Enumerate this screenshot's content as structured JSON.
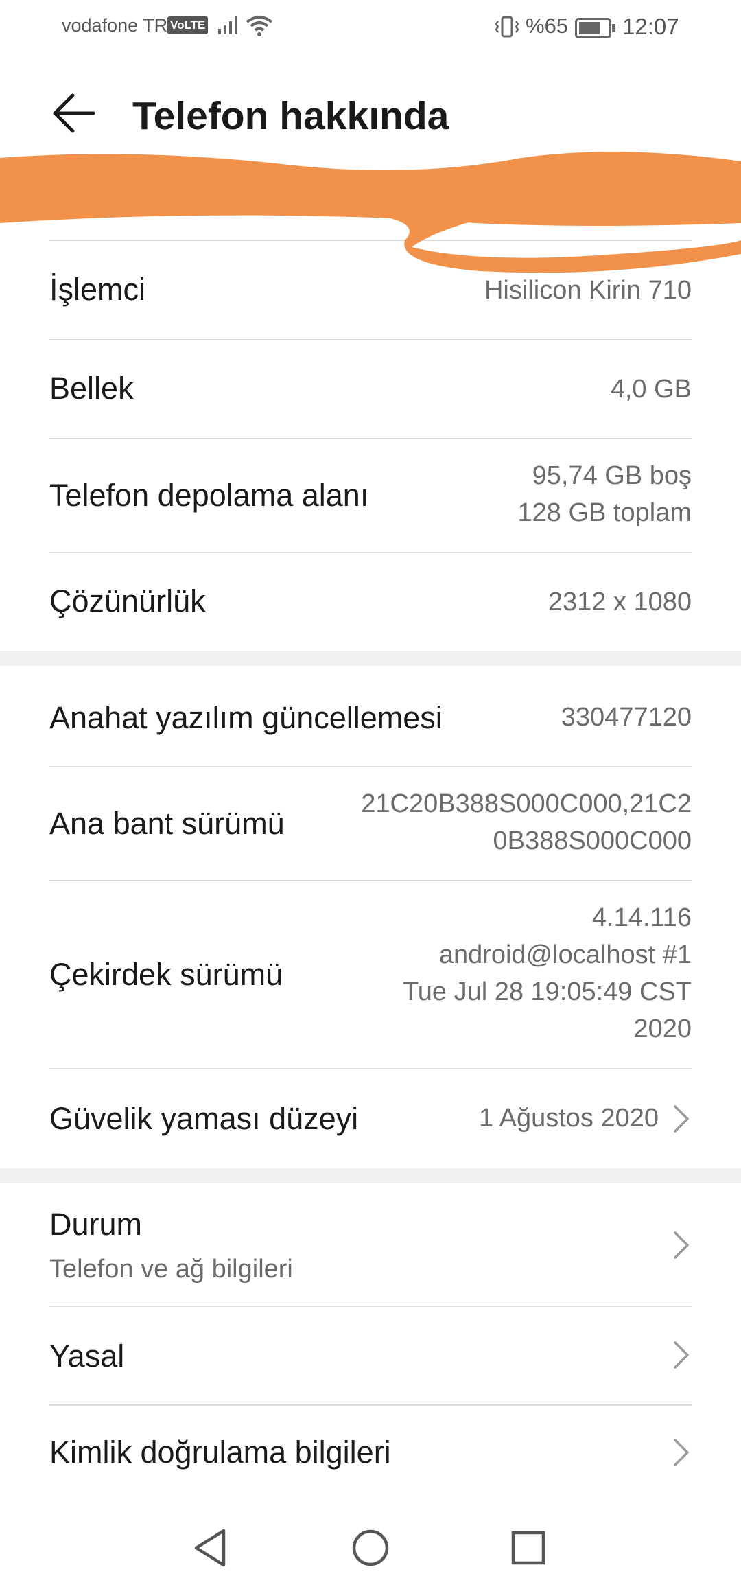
{
  "status_bar": {
    "carrier": "vodafone TR",
    "volte": "VoLTE",
    "battery_percent": "%65",
    "time": "12:07",
    "icons": [
      "signal-icon",
      "wifi-icon",
      "vibrate-icon",
      "battery-icon"
    ]
  },
  "header": {
    "title": "Telefon hakkında",
    "back_icon": "back-arrow-icon"
  },
  "specs": [
    {
      "label": "İşlemci",
      "value": "Hisilicon Kirin 710"
    },
    {
      "label": "Bellek",
      "value": "4,0 GB"
    },
    {
      "label": "Telefon depolama alanı",
      "value_lines": [
        "95,74  GB boş",
        "128  GB toplam"
      ]
    },
    {
      "label": "Çözünürlük",
      "value": "2312 x 1080"
    }
  ],
  "software": [
    {
      "label": "Anahat yazılım güncellemesi",
      "value": "330477120"
    },
    {
      "label": "Ana bant sürümü",
      "value_lines": [
        "21C20B388S000C000,21C2",
        "0B388S000C000"
      ]
    },
    {
      "label": "Çekirdek sürümü",
      "value_lines": [
        "4.14.116",
        "android@localhost #1",
        "Tue Jul 28 19:05:49 CST",
        "2020"
      ]
    },
    {
      "label": "Güvelik yaması düzeyi",
      "value": "1 Ağustos 2020"
    }
  ],
  "more": [
    {
      "label": "Durum",
      "sublabel": "Telefon ve ağ bilgileri"
    },
    {
      "label": "Yasal"
    },
    {
      "label": "Kimlik doğrulama bilgileri"
    }
  ],
  "colors": {
    "scribble": "#F2924A",
    "text_primary": "#1a1a1a",
    "text_secondary": "#6b6b6b",
    "divider": "#dcdcdc",
    "section_gap": "#efefef"
  },
  "nav_bar": {
    "icons": [
      "back-triangle-icon",
      "home-circle-icon",
      "recents-square-icon"
    ]
  }
}
